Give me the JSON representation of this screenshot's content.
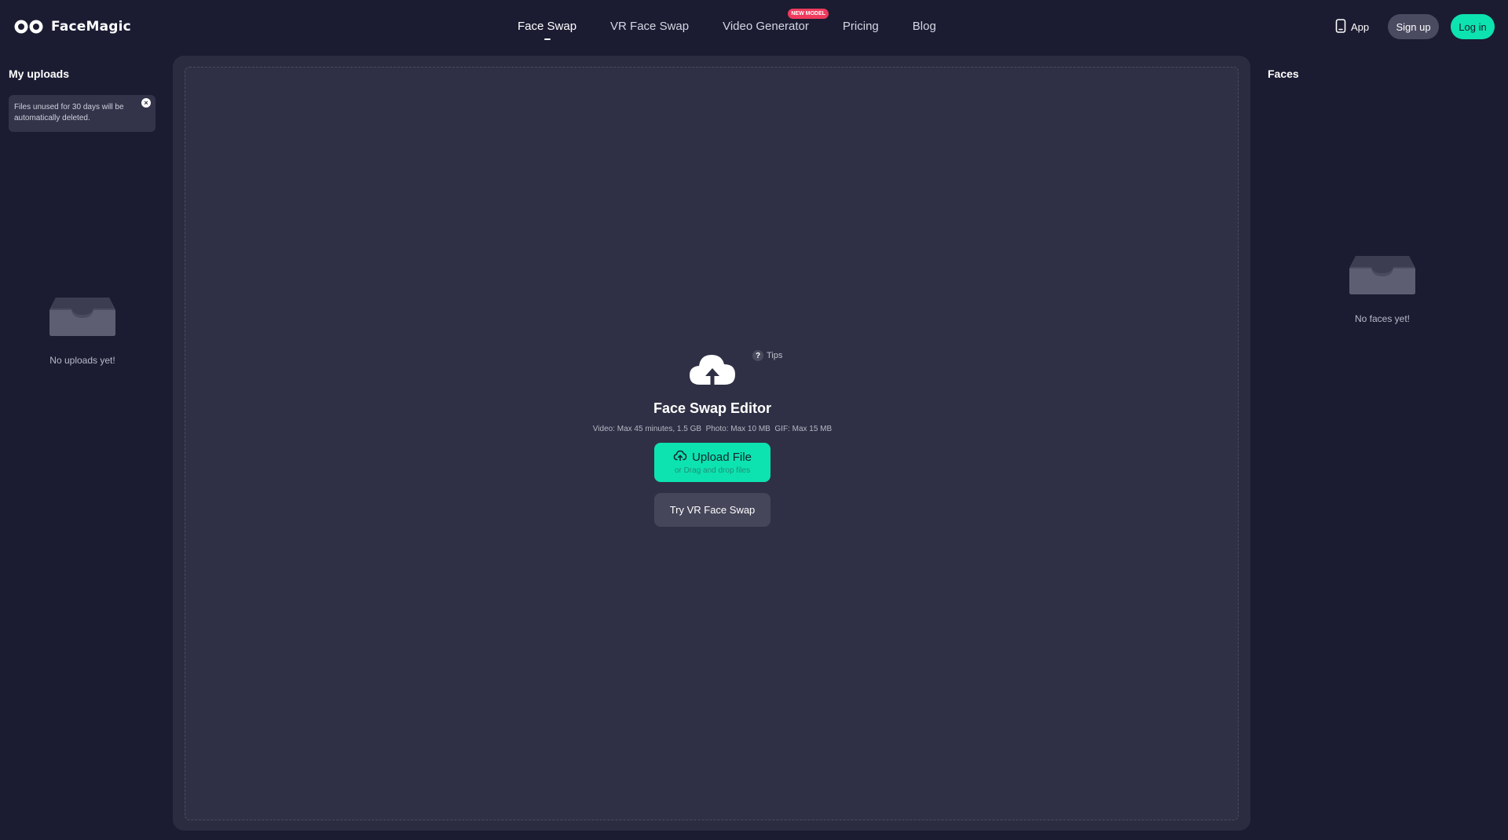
{
  "brand": {
    "name": "FaceMagic",
    "icon": "facemagic-logo-icon"
  },
  "nav": {
    "items": [
      {
        "label": "Face Swap",
        "active": true
      },
      {
        "label": "VR Face Swap",
        "active": false
      },
      {
        "label": "Video Generator",
        "active": false,
        "badge": "NEW MODEL"
      },
      {
        "label": "Pricing",
        "active": false
      },
      {
        "label": "Blog",
        "active": false
      }
    ]
  },
  "header_actions": {
    "app_label": "App",
    "app_icon": "phone-icon",
    "signup_label": "Sign up",
    "login_label": "Log in"
  },
  "uploads": {
    "title": "My uploads",
    "notice": "Files unused for 30 days will be automatically deleted.",
    "empty_text": "No uploads yet!"
  },
  "editor": {
    "tips_label": "Tips",
    "title": "Face Swap Editor",
    "limits": "Video: Max 45 minutes, 1.5 GB  Photo: Max 10 MB  GIF: Max 15 MB",
    "upload_label": "Upload File",
    "upload_sub": "or Drag and drop files",
    "vr_label": "Try VR Face Swap"
  },
  "faces": {
    "title": "Faces",
    "empty_text": "No faces yet!"
  },
  "colors": {
    "background": "#1b1c32",
    "panel": "#2b2c40",
    "accent": "#0de3b0",
    "badge": "#ef3a5d"
  }
}
